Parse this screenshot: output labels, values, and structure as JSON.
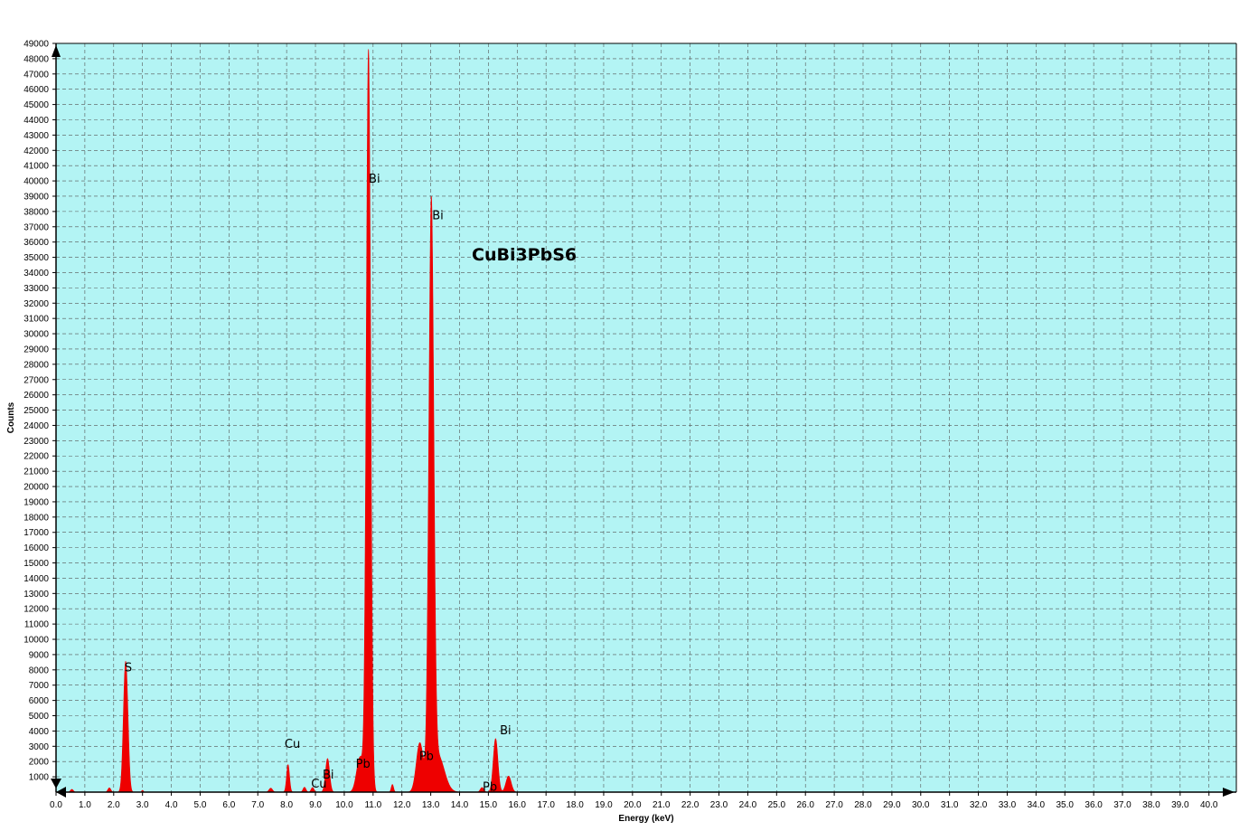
{
  "chart_data": {
    "type": "area",
    "title": "CuBi3PbS6",
    "xlabel": "Energy (keV)",
    "ylabel": "Counts",
    "xlim": [
      0,
      40.95
    ],
    "ylim": [
      0,
      49000
    ],
    "x_tick_step": 1.0,
    "y_tick_step": 1000,
    "grid": true,
    "colors": {
      "plot_background": "#b3f4f4",
      "spectrum": "#ee0000",
      "grid": "#555555"
    },
    "peaks": [
      {
        "x": 0.55,
        "height": 180,
        "width": 0.05
      },
      {
        "x": 1.85,
        "height": 280,
        "width": 0.05
      },
      {
        "x": 2.4,
        "height": 7450,
        "width": 0.07
      },
      {
        "x": 2.48,
        "height": 2300,
        "width": 0.06
      },
      {
        "x": 3.0,
        "height": 120,
        "width": 0.03
      },
      {
        "x": 7.45,
        "height": 260,
        "width": 0.06
      },
      {
        "x": 8.05,
        "height": 1800,
        "width": 0.05
      },
      {
        "x": 8.62,
        "height": 320,
        "width": 0.05
      },
      {
        "x": 8.9,
        "height": 300,
        "width": 0.05
      },
      {
        "x": 9.42,
        "height": 2200,
        "width": 0.07
      },
      {
        "x": 10.55,
        "height": 2300,
        "width": 0.12
      },
      {
        "x": 10.84,
        "height": 48500,
        "width": 0.075
      },
      {
        "x": 11.67,
        "height": 500,
        "width": 0.04
      },
      {
        "x": 12.62,
        "height": 3200,
        "width": 0.12
      },
      {
        "x": 13.02,
        "height": 37600,
        "width": 0.085
      },
      {
        "x": 13.25,
        "height": 2400,
        "width": 0.22
      },
      {
        "x": 14.78,
        "height": 300,
        "width": 0.06
      },
      {
        "x": 15.25,
        "height": 3500,
        "width": 0.08
      },
      {
        "x": 15.7,
        "height": 1050,
        "width": 0.09
      }
    ],
    "annotations": [
      {
        "label": "S",
        "x": 2.38,
        "y": 7900
      },
      {
        "label": "Cu",
        "x": 7.93,
        "y": 2900
      },
      {
        "label": "Cu",
        "x": 8.85,
        "y": 300
      },
      {
        "label": "Bi",
        "x": 9.25,
        "y": 900
      },
      {
        "label": "Bi",
        "x": 10.85,
        "y": 39900
      },
      {
        "label": "Pb",
        "x": 10.4,
        "y": 1600
      },
      {
        "label": "Bi",
        "x": 13.05,
        "y": 37500
      },
      {
        "label": "Pb",
        "x": 12.6,
        "y": 2100
      },
      {
        "label": "Bi",
        "x": 15.4,
        "y": 3800
      },
      {
        "label": "Pb",
        "x": 14.8,
        "y": 100
      }
    ]
  }
}
